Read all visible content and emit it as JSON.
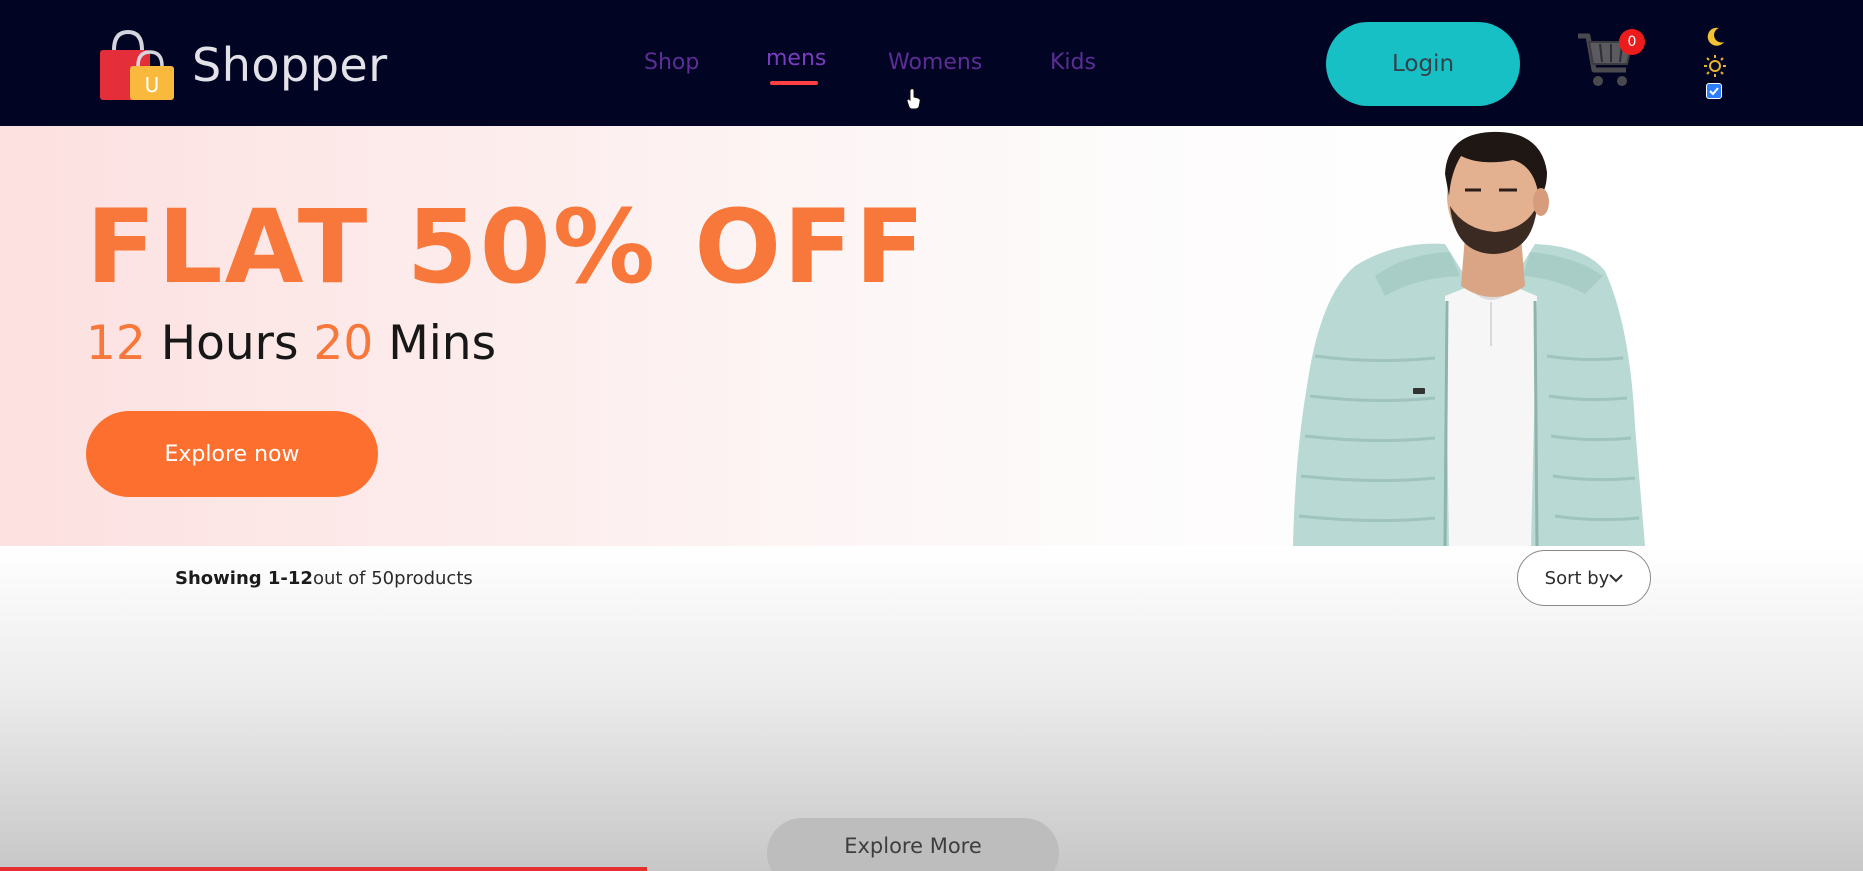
{
  "navbar": {
    "brand": "Shopper",
    "logo_letter": "U",
    "menu": [
      {
        "label": "Shop"
      },
      {
        "label": "mens",
        "active": true
      },
      {
        "label": "Womens"
      },
      {
        "label": "Kids"
      }
    ],
    "login_label": "Login",
    "cart_count": "0",
    "icons": [
      "cart-icon",
      "moon-icon",
      "sun-icon",
      "hand-pointer-icon"
    ],
    "theme_toggle_checked": true,
    "colors": {
      "background": "#020424",
      "menu_text": "#5d2d96",
      "active_underline": "#ff4141",
      "login_bg": "#16c0c4",
      "badge": "#ec1c1c"
    }
  },
  "hero": {
    "title": "FLAT 50% OFF",
    "timer": {
      "hours": "12",
      "hours_label": "Hours",
      "mins": "20",
      "mins_label": "Mins"
    },
    "cta_label": "Explore now",
    "colors": {
      "accent": "#f7783a",
      "cta_bg": "#fc6f2f"
    }
  },
  "products": {
    "showing_range": "Showing 1-12",
    "showing_out_of": "out of ",
    "showing_total": "50",
    "showing_suffix": "products",
    "sort_label": "Sort by",
    "sort_icon": "chevron-down-icon",
    "explore_more_label": "Explore More"
  }
}
